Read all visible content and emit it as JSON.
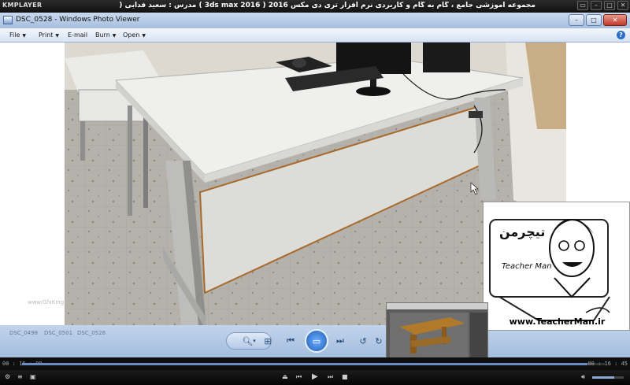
{
  "kmplayer": {
    "logo": "KMPLAYER",
    "title": "مجموعه آموزشی جامع ، گام به گام و کاربردی نرم افزار تری دی مکس 2016 ( 3ds max 2016 )  مدرس : سعید فدایی ( تیچرمن ) گروه آموزشی پادشاه گرافیست ها",
    "time_elapsed": "00 : 16 : 09",
    "time_total": "00 : 16 : 45",
    "progress": 0.97
  },
  "photo_viewer": {
    "window_title": "DSC_0528 - Windows Photo Viewer",
    "menu": [
      "File",
      "Print",
      "E-mail",
      "Burn",
      "Open"
    ],
    "help_label": "?",
    "faded_thumbs": [
      "DSC_0498",
      "DSC_0501",
      "DSC_0528"
    ]
  },
  "watermark": {
    "brand_fa": "تیچرمن",
    "brand_en": "Teacher Man",
    "url": "www.TeacherMan.ir",
    "left_site": "www.GfxKing.ir"
  },
  "colors": {
    "accent": "#2a6fc9",
    "photo_viewer_bar": "#a7bfdf"
  }
}
